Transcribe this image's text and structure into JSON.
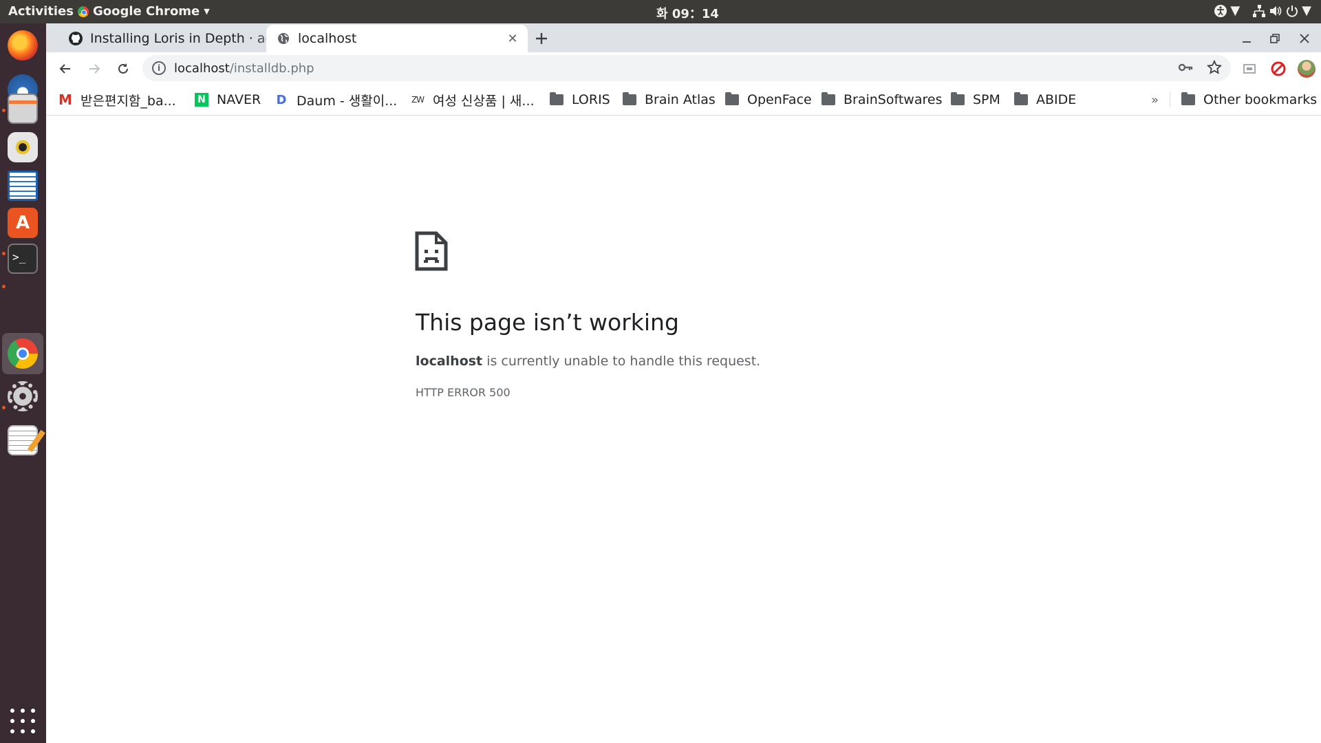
{
  "topbar": {
    "activities": "Activities",
    "app_name": "Google Chrome",
    "clock": "화 09：14"
  },
  "dock": {
    "items": [
      "firefox-icon",
      "thunderbird-icon",
      "files-icon",
      "rhythmbox-icon",
      "writer-icon",
      "software-icon",
      "terminal-icon",
      "chrome-icon",
      "settings-icon",
      "text-editor-icon"
    ]
  },
  "tabs": [
    {
      "title": "Installing Loris in Depth · aces/Loris Wiki"
    },
    {
      "title": "localhost"
    }
  ],
  "omnibox": {
    "host": "localhost",
    "path": "/installdb.php"
  },
  "bookmarks": {
    "items": [
      {
        "label": "받은편지함_ba..."
      },
      {
        "label": "NAVER"
      },
      {
        "label": "Daum - 생활이..."
      },
      {
        "label": "여성 신상품 | 새..."
      },
      {
        "label": "LORIS"
      },
      {
        "label": "Brain Atlas"
      },
      {
        "label": "OpenFace"
      },
      {
        "label": "BrainSoftwares"
      },
      {
        "label": "SPM"
      },
      {
        "label": "ABIDE"
      }
    ],
    "overflow": "»",
    "other": "Other bookmarks"
  },
  "error": {
    "title": "This page isn’t working",
    "host": "localhost",
    "message": "is currently unable to handle this request.",
    "code": "HTTP ERROR 500"
  }
}
